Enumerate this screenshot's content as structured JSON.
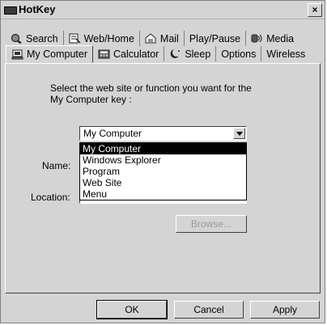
{
  "window": {
    "title": "HotKey",
    "close_glyph": "×"
  },
  "tabs_row1": [
    {
      "label": "Search",
      "icon": "search-icon"
    },
    {
      "label": "Web/Home",
      "icon": "web-home-icon"
    },
    {
      "label": "Mail",
      "icon": "mail-icon"
    },
    {
      "label": "Play/Pause",
      "icon": ""
    },
    {
      "label": "Media",
      "icon": "media-icon"
    }
  ],
  "tabs_row2": [
    {
      "label": "My Computer",
      "icon": "computer-icon",
      "active": true
    },
    {
      "label": "Calculator",
      "icon": "calculator-icon"
    },
    {
      "label": "Sleep",
      "icon": "sleep-icon"
    },
    {
      "label": "Options",
      "icon": ""
    },
    {
      "label": "Wireless",
      "icon": ""
    }
  ],
  "form": {
    "instruction": "Select the web site or function you want for the My Computer key :",
    "combo_value": "My Computer",
    "name_label": "Name:",
    "location_label": "Location:",
    "browse_label": "Browse..."
  },
  "dropdown": {
    "options": [
      "My Computer",
      "Windows Explorer",
      "Program",
      "Web Site",
      "Menu"
    ],
    "selected": "My Computer"
  },
  "footer": {
    "ok": "OK",
    "cancel": "Cancel",
    "apply": "Apply"
  }
}
